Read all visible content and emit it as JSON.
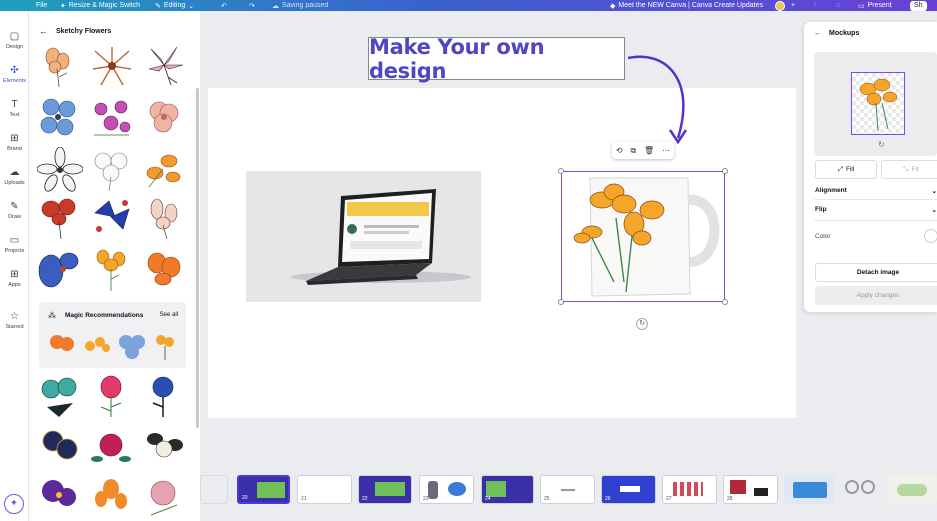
{
  "topbar": {
    "file": "File",
    "resize": "Resize & Magic Switch",
    "editing": "Editing",
    "saving": "Saving paused",
    "doc_title": "Meet the NEW Canva | Canva Create Updates",
    "present": "Present",
    "share": "Sh"
  },
  "rail": {
    "items": [
      {
        "label": "Design",
        "icon": "layout-icon"
      },
      {
        "label": "Elements",
        "icon": "shapes-icon"
      },
      {
        "label": "Text",
        "icon": "text-icon"
      },
      {
        "label": "Brand",
        "icon": "briefcase-icon"
      },
      {
        "label": "Uploads",
        "icon": "cloud-upload-icon"
      },
      {
        "label": "Draw",
        "icon": "pen-icon"
      },
      {
        "label": "Projects",
        "icon": "folder-icon"
      },
      {
        "label": "Apps",
        "icon": "apps-grid-icon"
      },
      {
        "label": "Starred",
        "icon": "star-icon"
      }
    ]
  },
  "panel": {
    "title": "Sketchy Flowers",
    "magic_title": "Magic Recommendations",
    "see_all": "See all"
  },
  "canvas": {
    "headline": "Make Your own design"
  },
  "mockups": {
    "title": "Mockups",
    "fill": "Fill",
    "fit": "Fit",
    "alignment": "Alignment",
    "flip": "Flip",
    "color": "Color",
    "detach": "Detach image",
    "apply": "Apply changes"
  },
  "filmstrip": {
    "pages": [
      "20",
      "21",
      "22",
      "23",
      "24",
      "25",
      "26",
      "27",
      "28"
    ]
  },
  "colors": {
    "accent": "#5046c4",
    "selection": "#7b4ce0",
    "topbar_start": "#1f9fbd",
    "topbar_end": "#6a3fd6"
  }
}
